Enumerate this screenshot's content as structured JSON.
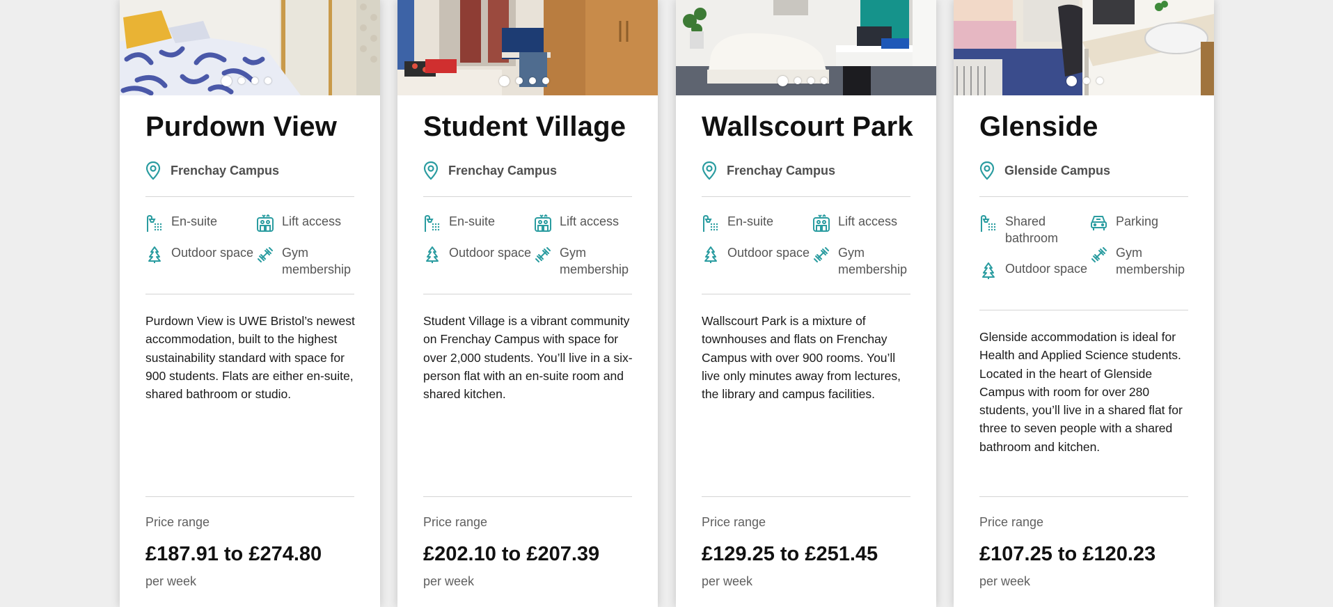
{
  "colors": {
    "accent": "#2a9ca0",
    "page_bg": "#eeeeee"
  },
  "cards": [
    {
      "title": "Purdown View",
      "campus": "Frenchay Campus",
      "features": [
        {
          "icon": "ensuite-shower-icon",
          "label": "En-suite"
        },
        {
          "icon": "lift-icon",
          "label": "Lift access"
        },
        {
          "icon": "tree-icon",
          "label": "Outdoor space"
        },
        {
          "icon": "dumbbell-icon",
          "label": "Gym membership"
        }
      ],
      "description": "Purdown View is UWE Bristol’s newest accommodation, built to the highest sustainability standard with space for 900 students. Flats are either en-suite, shared bathroom or studio.",
      "price_label": "Price range",
      "price": "£187.91 to £274.80",
      "per": "per week",
      "slides": 4,
      "active_slide": 0
    },
    {
      "title": "Student Village",
      "campus": "Frenchay Campus",
      "features": [
        {
          "icon": "ensuite-shower-icon",
          "label": "En-suite"
        },
        {
          "icon": "lift-icon",
          "label": "Lift access"
        },
        {
          "icon": "tree-icon",
          "label": "Outdoor space"
        },
        {
          "icon": "dumbbell-icon",
          "label": "Gym membership"
        }
      ],
      "description": "Student Village is a vibrant community on Frenchay Campus with space for over 2,000 students. You’ll live in a six-person flat with an en-suite room and shared kitchen.",
      "price_label": "Price range",
      "price": "£202.10 to £207.39",
      "per": "per week",
      "slides": 4,
      "active_slide": 0
    },
    {
      "title": "Wallscourt Park",
      "campus": "Frenchay Campus",
      "features": [
        {
          "icon": "ensuite-shower-icon",
          "label": "En-suite"
        },
        {
          "icon": "lift-icon",
          "label": "Lift access"
        },
        {
          "icon": "tree-icon",
          "label": "Outdoor space"
        },
        {
          "icon": "dumbbell-icon",
          "label": "Gym membership"
        }
      ],
      "description": "Wallscourt Park is a mixture of townhouses and flats on Frenchay Campus with over 900 rooms. You’ll live only minutes away from lectures, the library and campus facilities.",
      "price_label": "Price range",
      "price": "£129.25 to £251.45",
      "per": "per week",
      "slides": 4,
      "active_slide": 0
    },
    {
      "title": "Glenside",
      "campus": "Glenside Campus",
      "features": [
        {
          "icon": "shared-bathroom-icon",
          "label": "Shared bathroom"
        },
        {
          "icon": "car-icon",
          "label": "Parking"
        },
        {
          "icon": "tree-icon",
          "label": "Outdoor space"
        },
        {
          "icon": "dumbbell-icon",
          "label": "Gym membership"
        }
      ],
      "description": "Glenside accommodation is ideal for Health and Applied Science students. Located in the heart of Glenside Campus with room for over 280 students, you’ll live in a shared flat for three to seven people with a shared bathroom and kitchen.",
      "price_label": "Price range",
      "price": "£107.25 to £120.23",
      "per": "per week",
      "slides": 3,
      "active_slide": 0
    }
  ]
}
